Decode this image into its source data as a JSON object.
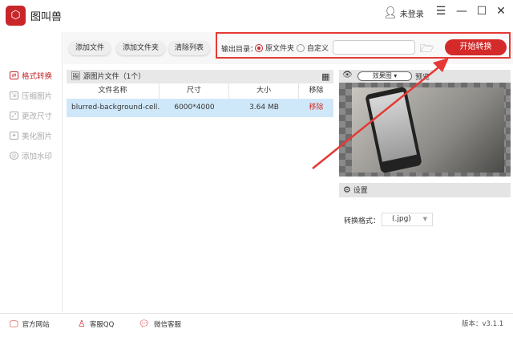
{
  "app": {
    "title": "图叫兽",
    "user": "未登录"
  },
  "sidebar": {
    "items": [
      {
        "label": "格式转换",
        "active": true
      },
      {
        "label": "压缩图片"
      },
      {
        "label": "更改尺寸"
      },
      {
        "label": "美化图片"
      },
      {
        "label": "添加水印"
      }
    ]
  },
  "toolbar": {
    "add_file": "添加文件",
    "add_folder": "添加文件夹",
    "clear_list": "清除列表"
  },
  "output": {
    "label": "输出目录：",
    "option_source": "原文件夹",
    "option_custom": "自定义",
    "path_value": "",
    "start": "开始转换"
  },
  "files": {
    "title": "源图片文件（1个）",
    "columns": [
      "文件名称",
      "尺寸",
      "大小",
      "移除"
    ],
    "rows": [
      {
        "name": "blurred-background-cell...",
        "dimensions": "6000*4000",
        "size": "3.64 MB",
        "remove": "移除"
      }
    ]
  },
  "preview": {
    "mode": "效果图",
    "label": "预览"
  },
  "settings": {
    "title": "设置",
    "format_label": "转换格式：",
    "format_value": "(.jpg)"
  },
  "footer": {
    "website": "官方网站",
    "qq": "客服QQ",
    "wechat": "微信客服",
    "version": "版本：v3.1.1"
  },
  "colors": {
    "accent": "#d42a2a",
    "highlight": "#e53935",
    "row_selected": "#cfe8f9"
  }
}
